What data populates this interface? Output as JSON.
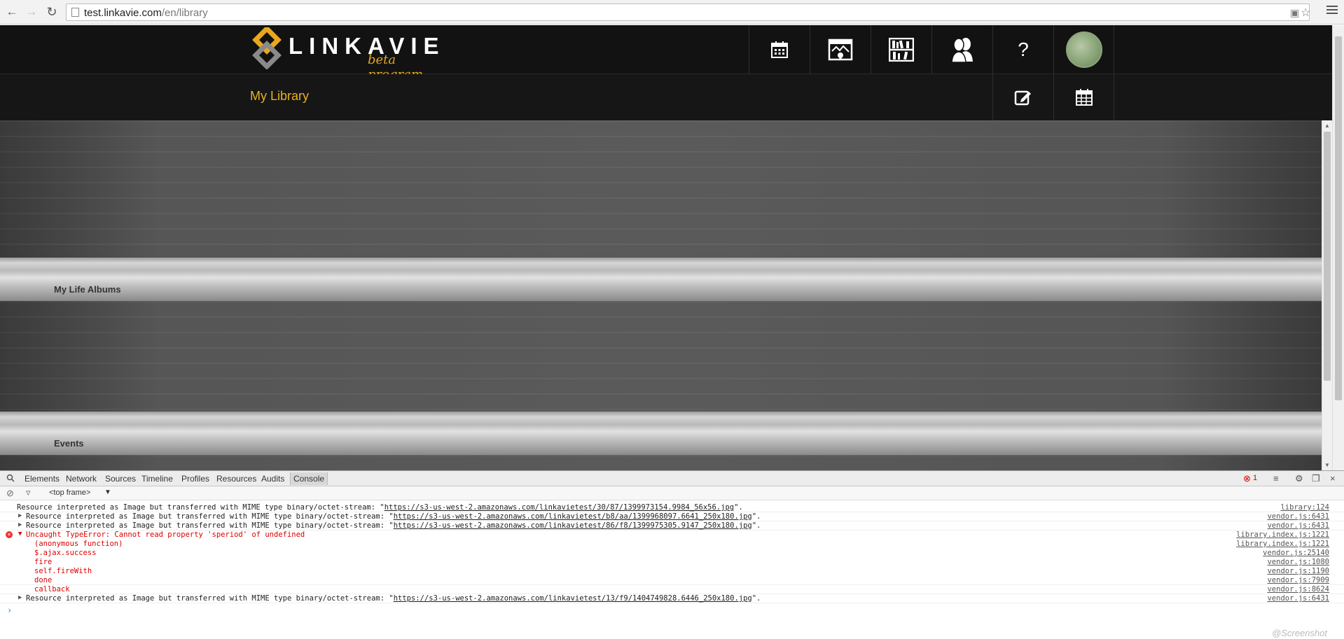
{
  "browser": {
    "url_host": "test.linkavie.com",
    "url_path": "/en/library"
  },
  "site": {
    "logo_text": "LINKAVIE",
    "logo_sub": "beta program",
    "help_label": "?",
    "page_title": "My Library",
    "shelves": [
      {
        "label": "My Life Albums"
      },
      {
        "label": "Events"
      }
    ]
  },
  "devtools": {
    "tabs": [
      "Elements",
      "Network",
      "Sources",
      "Timeline",
      "Profiles",
      "Resources",
      "Audits",
      "Console"
    ],
    "error_count": "1",
    "frame_selector": "<top frame>",
    "messages": [
      {
        "text": "Resource interpreted as Image but transferred with MIME type binary/octet-stream: \"",
        "link": "https://s3-us-west-2.amazonaws.com/linkavietest/30/87/1399973154.9984_56x56.jpg",
        "tail": "\".",
        "source": "library:124"
      },
      {
        "text": "Resource interpreted as Image but transferred with MIME type binary/octet-stream: \"",
        "link": "https://s3-us-west-2.amazonaws.com/linkavietest/b8/aa/1399968097.6641_250x180.jpg",
        "tail": "\".",
        "source": "vendor.js:6431"
      },
      {
        "text": "Resource interpreted as Image but transferred with MIME type binary/octet-stream: \"",
        "link": "https://s3-us-west-2.amazonaws.com/linkavietest/86/f8/1399975305.9147_250x180.jpg",
        "tail": "\".",
        "source": "vendor.js:6431"
      }
    ],
    "error": {
      "text": "Uncaught TypeError: Cannot read property 'speriod' of undefined",
      "source": "library.index.js:1221",
      "stack": [
        {
          "fn": "(anonymous function)",
          "src": "library.index.js:1221"
        },
        {
          "fn": "$.ajax.success",
          "src": "vendor.js:25140"
        },
        {
          "fn": "fire",
          "src": "vendor.js:1080"
        },
        {
          "fn": "self.fireWith",
          "src": "vendor.js:1190"
        },
        {
          "fn": "done",
          "src": "vendor.js:7909"
        },
        {
          "fn": "callback",
          "src": "vendor.js:8624"
        }
      ]
    },
    "last_message": {
      "text": "Resource interpreted as Image but transferred with MIME type binary/octet-stream: \"",
      "link": "https://s3-us-west-2.amazonaws.com/linkavietest/13/f9/1404749828.6446_250x180.jpg",
      "tail": "\".",
      "source": "vendor.js:6431"
    },
    "watermark": "@Screenshot"
  }
}
